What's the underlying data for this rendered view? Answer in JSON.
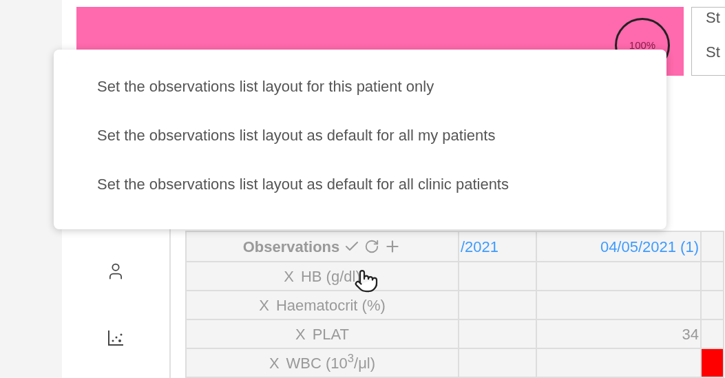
{
  "banner": {
    "progress": "100%"
  },
  "side_card": {
    "lines": [
      "St",
      "St"
    ]
  },
  "popover": {
    "items": [
      "Set the observations list layout for this patient only",
      "Set the observations list layout as default for all my patients",
      "Set the observations list layout as default for all clinic patients"
    ]
  },
  "table": {
    "columns": [
      "Observations",
      "/2021",
      "04/05/2021 (1)",
      ""
    ],
    "rows": [
      {
        "cells": [
          {
            "remove": "X",
            "text": "HB (g/dl)",
            "highlighted": false
          },
          {
            "text": "",
            "highlighted": false
          },
          {
            "text": "",
            "highlighted": false
          },
          {
            "text": "",
            "highlighted": false
          }
        ]
      },
      {
        "cells": [
          {
            "remove": "X",
            "text": "Haematocrit (%)",
            "highlighted": false
          },
          {
            "text": "",
            "highlighted": false
          },
          {
            "text": "",
            "highlighted": false
          },
          {
            "text": "",
            "highlighted": false
          }
        ]
      },
      {
        "cells": [
          {
            "remove": "X",
            "text": "PLAT",
            "highlighted": false
          },
          {
            "text": "",
            "highlighted": false
          },
          {
            "text": "34",
            "highlighted": false
          },
          {
            "text": "",
            "highlighted": false
          }
        ]
      },
      {
        "cells": [
          {
            "remove": "X",
            "text": "WBC (10$^{3}$/μl)",
            "highlighted": false
          },
          {
            "text": "",
            "highlighted": false
          },
          {
            "text": "",
            "highlighted": false
          },
          {
            "text": "",
            "highlighted": true
          }
        ]
      }
    ]
  }
}
